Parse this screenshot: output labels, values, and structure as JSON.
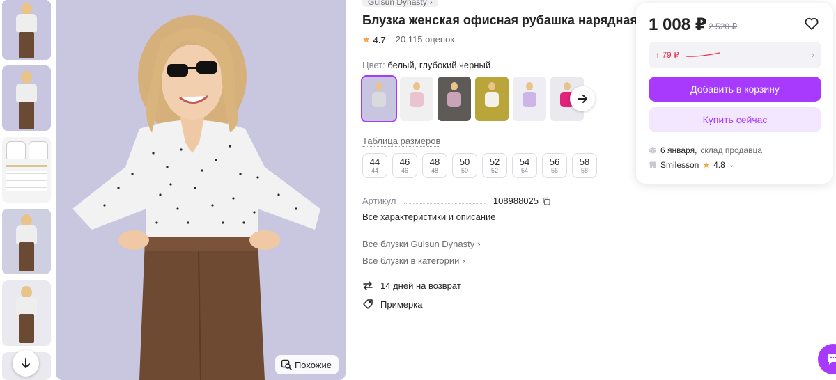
{
  "thumbnails": {
    "items": [
      {
        "name": "thumb-1",
        "active": true
      },
      {
        "name": "thumb-2",
        "active": false
      },
      {
        "name": "thumb-3-size-chart",
        "active": false
      },
      {
        "name": "thumb-4",
        "active": false
      },
      {
        "name": "thumb-5",
        "active": false
      },
      {
        "name": "thumb-6",
        "active": false
      }
    ],
    "down_icon": "arrow-down-icon"
  },
  "gallery": {
    "similar_label": "Похожие",
    "similar_icon": "image-search-icon"
  },
  "product": {
    "brand": "Gulsun Dynasty",
    "title": "Блузка женская офисная рубашка нарядная",
    "rating": "4.7",
    "reviews": "20 115 оценок",
    "color_label": "Цвет:",
    "color_value": "белый, глубокий черный",
    "size_table_label": "Таблица размеров",
    "sizes": [
      {
        "ru": "44",
        "eu": "44"
      },
      {
        "ru": "46",
        "eu": "46"
      },
      {
        "ru": "48",
        "eu": "48"
      },
      {
        "ru": "50",
        "eu": "50"
      },
      {
        "ru": "52",
        "eu": "52"
      },
      {
        "ru": "54",
        "eu": "54"
      },
      {
        "ru": "56",
        "eu": "56"
      },
      {
        "ru": "58",
        "eu": "58"
      }
    ],
    "article_label": "Артикул",
    "article_value": "108988025",
    "all_characteristics": "Все характеристики и описание",
    "link_brand": "Все блузки Gulsun Dynasty",
    "link_category": "Все блузки в категории",
    "return_text": "14 дней на возврат",
    "fitting_text": "Примерка"
  },
  "swatches": {
    "colors": [
      "#d9d9de",
      "#e9c3cf",
      "#c9a4b6",
      "#f4f1ea",
      "#cdb5e8",
      "#e2217a"
    ],
    "bgs": [
      "#c7c5df",
      "#f0f0f0",
      "#5e5a58",
      "#b9a53a",
      "#ededf3",
      "#e9e9ee"
    ]
  },
  "card": {
    "price": "1 008 ₽",
    "old_price": "2 520 ₽",
    "wallet_up": "↑ 79 ₽",
    "add_to_cart": "Добавить в корзину",
    "buy_now": "Купить сейчас",
    "delivery_date": "6 января,",
    "delivery_source": "склад продавца",
    "seller_name": "Smilesson",
    "seller_rating": "4.8"
  },
  "colors": {
    "accent": "#a73afd",
    "accent_light": "#f3e7ff",
    "price_up": "#f5284b",
    "star": "#f2a33a"
  }
}
